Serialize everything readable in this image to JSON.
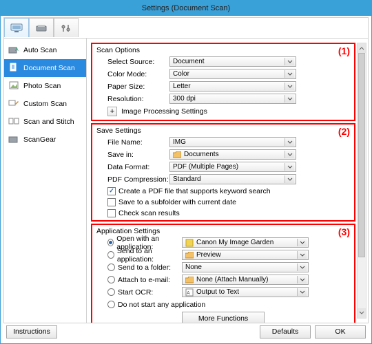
{
  "window": {
    "title": "Settings (Document Scan)"
  },
  "tabs": {
    "sidebar": [
      {
        "label": "Auto Scan"
      },
      {
        "label": "Document Scan"
      },
      {
        "label": "Photo Scan"
      },
      {
        "label": "Custom Scan"
      },
      {
        "label": "Scan and Stitch"
      },
      {
        "label": "ScanGear"
      }
    ]
  },
  "scan_options": {
    "section": "Scan Options",
    "select_source_label": "Select Source:",
    "select_source_value": "Document",
    "color_mode_label": "Color Mode:",
    "color_mode_value": "Color",
    "paper_size_label": "Paper Size:",
    "paper_size_value": "Letter",
    "resolution_label": "Resolution:",
    "resolution_value": "300 dpi",
    "image_processing": "Image Processing Settings"
  },
  "save_settings": {
    "section": "Save Settings",
    "file_name_label": "File Name:",
    "file_name_value": "IMG",
    "save_in_label": "Save in:",
    "save_in_value": "Documents",
    "data_format_label": "Data Format:",
    "data_format_value": "PDF (Multiple Pages)",
    "pdf_compression_label": "PDF Compression:",
    "pdf_compression_value": "Standard",
    "check_keyword": "Create a PDF file that supports keyword search",
    "check_subfolder": "Save to a subfolder with current date",
    "check_results": "Check scan results"
  },
  "app_settings": {
    "section": "Application Settings",
    "open_app_label": "Open with an application:",
    "open_app_value": "Canon My Image Garden",
    "send_app_label": "Send to an application:",
    "send_app_value": "Preview",
    "send_folder_label": "Send to a folder:",
    "send_folder_value": "None",
    "attach_email_label": "Attach to e-mail:",
    "attach_email_value": "None (Attach Manually)",
    "start_ocr_label": "Start OCR:",
    "start_ocr_value": "Output to Text",
    "do_not_start": "Do not start any application",
    "more_functions": "More Functions"
  },
  "footer": {
    "instructions": "Instructions",
    "defaults": "Defaults",
    "ok": "OK"
  },
  "annotations": {
    "one": "(1)",
    "two": "(2)",
    "three": "(3)"
  }
}
